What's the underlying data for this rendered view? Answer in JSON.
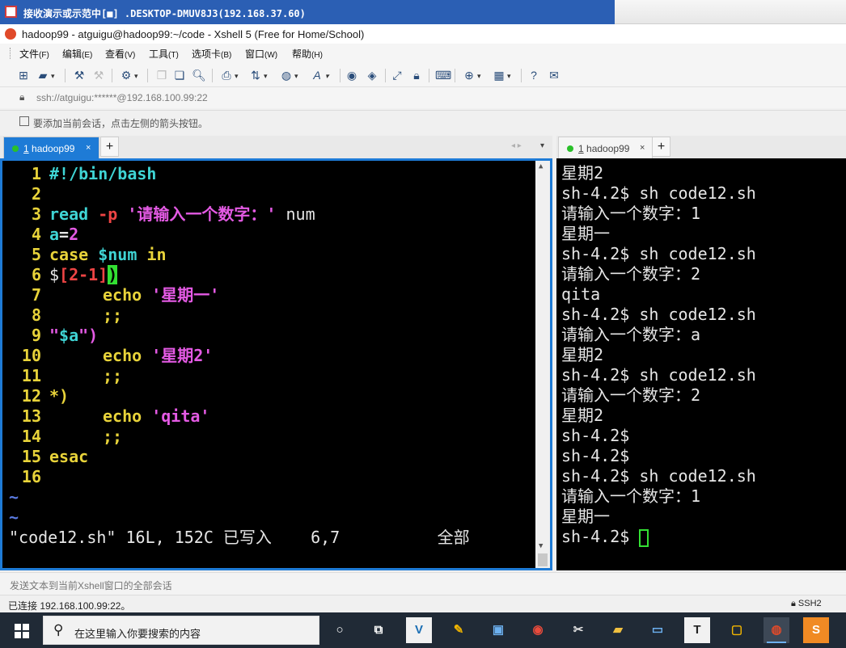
{
  "remote_window": {
    "title": "接收演示或示范中[■] .DESKTOP-DMUV8J3(192.168.37.60)"
  },
  "app": {
    "title": "hadoop99 - atguigu@hadoop99:~/code - Xshell 5 (Free for Home/School)"
  },
  "menu": [
    {
      "label": "文件",
      "key": "(F)"
    },
    {
      "label": "编辑",
      "key": "(E)"
    },
    {
      "label": "查看",
      "key": "(V)"
    },
    {
      "label": "工具",
      "key": "(T)"
    },
    {
      "label": "选项卡",
      "key": "(B)"
    },
    {
      "label": "窗口",
      "key": "(W)"
    },
    {
      "label": "帮助",
      "key": "(H)"
    }
  ],
  "address": {
    "text": "ssh://atguigu:******@192.168.100.99:22"
  },
  "hint": {
    "text": "要添加当前会话，点击左侧的箭头按钮。"
  },
  "tabs": {
    "left": {
      "num": "1",
      "name": "hadoop99",
      "close": "×"
    },
    "right": {
      "num": "1",
      "name": "hadoop99",
      "close": "×"
    },
    "plus": "+",
    "nav_arrows": "◂ ▸",
    "menu_arrow": "▾"
  },
  "editor": {
    "lines": [
      {
        "n": "1"
      },
      {
        "n": "2"
      },
      {
        "n": "3"
      },
      {
        "n": "4"
      },
      {
        "n": "5"
      },
      {
        "n": "6"
      },
      {
        "n": "7"
      },
      {
        "n": "8"
      },
      {
        "n": "9"
      },
      {
        "n": "10"
      },
      {
        "n": "11"
      },
      {
        "n": "12"
      },
      {
        "n": "13"
      },
      {
        "n": "14"
      },
      {
        "n": "15"
      },
      {
        "n": "16"
      }
    ],
    "code": {
      "l1": "#!/bin/bash",
      "l3_kw": "read",
      "l3_opt": "-p",
      "l3_str": "'请输入一个数字：'",
      "l3_var": "num",
      "l4_name": "a",
      "l4_eq": "=",
      "l4_val": "2",
      "l5_kw": "case",
      "l5_var": "$num",
      "l5_in": "in",
      "l6_a": "$",
      "l6_b": "[2-1]",
      "l6_c": ")",
      "l7_kw": "echo",
      "l7_str": "'星期一'",
      "l8": ";;",
      "l9_a": "\"",
      "l9_var": "$a",
      "l9_b": "\")",
      "l10_kw": "echo",
      "l10_str": "'星期2'",
      "l11": ";;",
      "l12": "*)",
      "l13_kw": "echo",
      "l13_str": "'qita'",
      "l14": ";;",
      "l15": "esac"
    },
    "tilde": "~",
    "status": "\"code12.sh\" 16L, 152C 已写入    6,7          全部"
  },
  "terminal_right": {
    "lines": [
      "星期2",
      "sh-4.2$ sh code12.sh",
      "请输入一个数字：1",
      "星期一",
      "sh-4.2$ sh code12.sh",
      "请输入一个数字：2",
      "qita",
      "sh-4.2$ sh code12.sh",
      "请输入一个数字：a",
      "星期2",
      "sh-4.2$ sh code12.sh",
      "请输入一个数字：2",
      "星期2",
      "sh-4.2$",
      "sh-4.2$",
      "sh-4.2$ sh code12.sh",
      "请输入一个数字：1",
      "星期一",
      "sh-4.2$ "
    ]
  },
  "sendbar": {
    "text": "发送文本到当前Xshell窗口的全部会话"
  },
  "statusbar": {
    "left": "已连接 192.168.100.99:22。",
    "right": "SSH2"
  },
  "taskbar": {
    "search_placeholder": "在这里输入你要搜索的内容",
    "apps": [
      "task-view",
      "vscode",
      "paint",
      "monitor",
      "chrome",
      "tools",
      "explorer",
      "remote-desktop",
      "typora",
      "vmware",
      "xshell",
      "sublime"
    ]
  },
  "colors": {
    "accent": "#1e7bd6",
    "terminal_bg": "#000000",
    "line_number": "#e8d33a",
    "keyword": "#3fd4d4",
    "string": "#e45ae4"
  }
}
